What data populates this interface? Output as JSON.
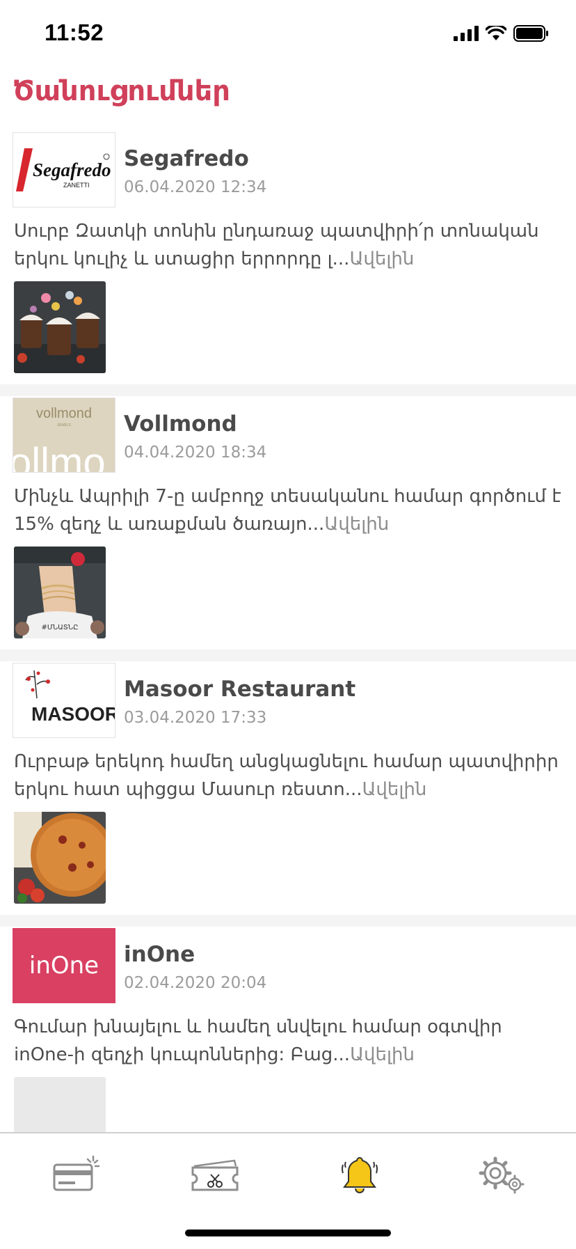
{
  "status_bar": {
    "time": "11:52"
  },
  "header": {
    "title": "Ծանուցումներ"
  },
  "feed": {
    "more_label": "Ավելին",
    "items": [
      {
        "brand": "Segafredo",
        "date": "06.04.2020 12:34",
        "text": "Սուրբ Զատկի տոնին ընդառաջ պատվիրի՛ր տոնական երկու կուլիչ և ստացիր երրորդը լ...",
        "logo_text": "Segafredo",
        "logo_subtext": "ZANETTI"
      },
      {
        "brand": "Vollmond",
        "date": "04.04.2020 18:34",
        "text": "Մինչև Ապրիլի 7-ը ամբողջ տեսականու համար գործում է 15% զեղչ և առաքման ծառայո...",
        "logo_text": "vollmond",
        "logo_subtext": "JEWELS",
        "thumb_caption": "#ՄՆԱՏՆԸ"
      },
      {
        "brand": "Masoor Restaurant",
        "date": "03.04.2020 17:33",
        "text": "Ուրբաթ երեկոդ համեղ անցկացնելու համար պատվիրիր երկու հատ պիցցա Մասուր ռեստո...",
        "logo_text": "MASOOR"
      },
      {
        "brand": "inOne",
        "date": "02.04.2020 20:04",
        "text": "Գումար խնայելու և համեղ սնվելու համար օգտվիր inOne-ի զեղչի կուպոններից: Բաց...",
        "logo_text": "inOne"
      }
    ]
  },
  "tab_bar": {
    "tabs": [
      {
        "icon": "card-icon",
        "active": false
      },
      {
        "icon": "coupon-icon",
        "active": false
      },
      {
        "icon": "bell-icon",
        "active": true
      },
      {
        "icon": "settings-icon",
        "active": false
      }
    ],
    "active_color": "#f5c518",
    "inactive_color": "#8e8e8e"
  },
  "colors": {
    "accent": "#d0405a",
    "inone_brand": "#d94062"
  }
}
